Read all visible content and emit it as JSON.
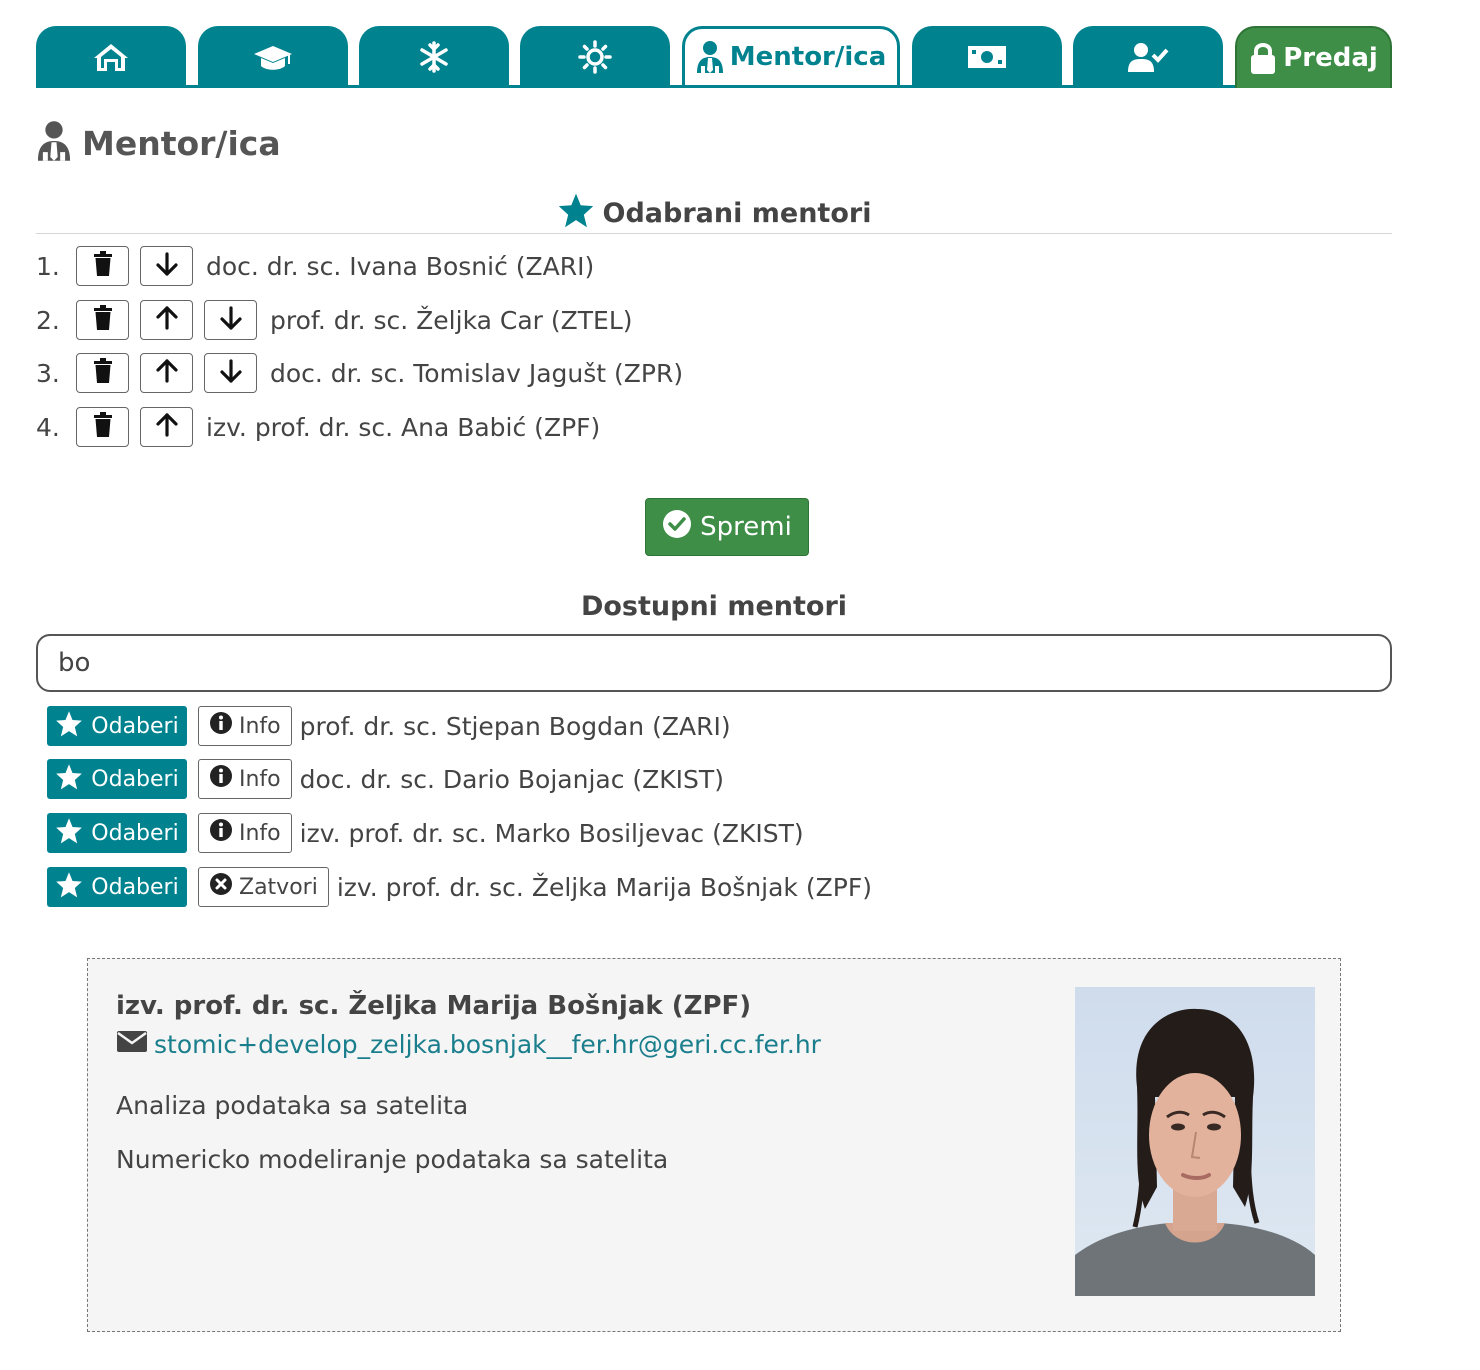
{
  "tabs": [
    {
      "icon": "home-icon",
      "label": ""
    },
    {
      "icon": "graduation-cap-icon",
      "label": ""
    },
    {
      "icon": "snowflake-icon",
      "label": ""
    },
    {
      "icon": "sun-icon",
      "label": ""
    },
    {
      "icon": "mentor-user-tie-icon",
      "label": "Mentor/ica",
      "active": true
    },
    {
      "icon": "money-bill-icon",
      "label": ""
    },
    {
      "icon": "user-check-icon",
      "label": ""
    },
    {
      "icon": "lock-icon",
      "label": "Predaj"
    }
  ],
  "colors": {
    "primary": "#00838f",
    "success": "#3e8e47",
    "text": "#444444"
  },
  "page": {
    "title": "Mentor/ica"
  },
  "selected": {
    "title": "Odabrani mentori",
    "items": [
      {
        "num": "1.",
        "name": "doc. dr. sc. Ivana Bosnić (ZARI)"
      },
      {
        "num": "2.",
        "name": "prof. dr. sc. Željka Car (ZTEL)"
      },
      {
        "num": "3.",
        "name": "doc. dr. sc. Tomislav Jagušt (ZPR)"
      },
      {
        "num": "4.",
        "name": "izv. prof. dr. sc. Ana Babić (ZPF)"
      }
    ]
  },
  "save_label": "Spremi",
  "available": {
    "title": "Dostupni mentori",
    "search_value": "bo",
    "select_label": "Odaberi",
    "info_label": "Info",
    "close_label": "Zatvori",
    "items": [
      {
        "name": "prof. dr. sc. Stjepan Bogdan (ZARI)",
        "state": "info"
      },
      {
        "name": "doc. dr. sc. Dario Bojanjac (ZKIST)",
        "state": "info"
      },
      {
        "name": "izv. prof. dr. sc. Marko Bosiljevac (ZKIST)",
        "state": "info"
      },
      {
        "name": "izv. prof. dr. sc. Željka Marija Bošnjak (ZPF)",
        "state": "open"
      }
    ]
  },
  "detail": {
    "name": "izv. prof. dr. sc. Željka Marija Bošnjak (ZPF)",
    "email": "stomic+develop_zeljka.bosnjak__fer.hr@geri.cc.fer.hr",
    "topics": [
      "Analiza podataka sa satelita",
      "Numericko modeliranje podataka sa satelita"
    ]
  }
}
